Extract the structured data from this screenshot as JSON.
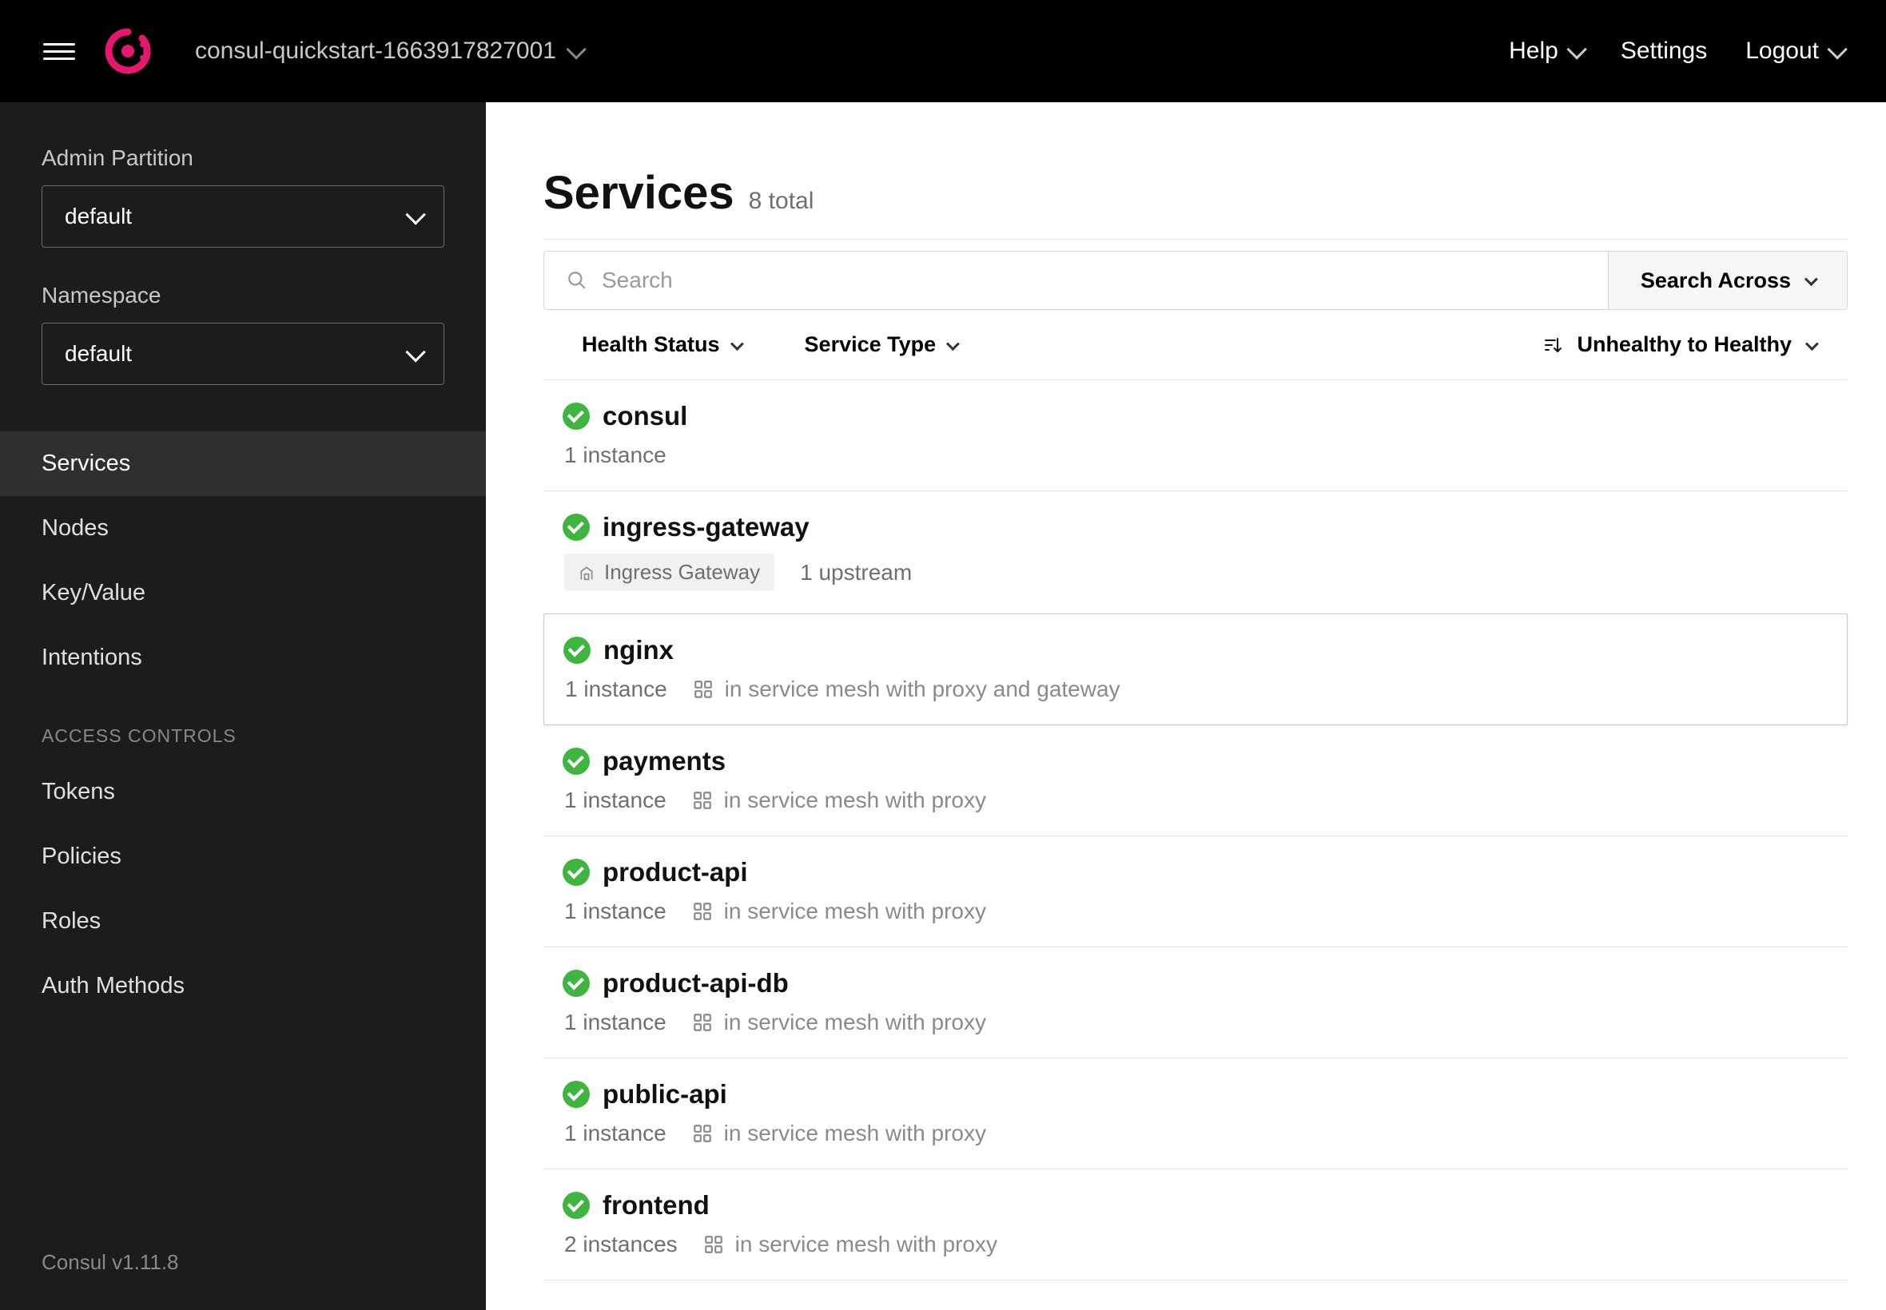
{
  "header": {
    "datacenter": "consul-quickstart-1663917827001",
    "help": "Help",
    "settings": "Settings",
    "logout": "Logout"
  },
  "sidebar": {
    "admin_partition_label": "Admin Partition",
    "admin_partition_value": "default",
    "namespace_label": "Namespace",
    "namespace_value": "default",
    "nav": {
      "services": "Services",
      "nodes": "Nodes",
      "keyvalue": "Key/Value",
      "intentions": "Intentions"
    },
    "access_controls_header": "ACCESS CONTROLS",
    "access": {
      "tokens": "Tokens",
      "policies": "Policies",
      "roles": "Roles",
      "auth_methods": "Auth Methods"
    },
    "version": "Consul v1.11.8"
  },
  "main": {
    "title": "Services",
    "subtitle": "8 total",
    "search_placeholder": "Search",
    "search_across": "Search Across",
    "filters": {
      "health_status": "Health Status",
      "service_type": "Service Type"
    },
    "sort_label": "Unhealthy to Healthy",
    "services": [
      {
        "name": "consul",
        "instances": "1 instance",
        "badge": null,
        "mesh": null,
        "extra": null
      },
      {
        "name": "ingress-gateway",
        "instances": null,
        "badge": "Ingress Gateway",
        "mesh": null,
        "extra": "1 upstream"
      },
      {
        "name": "nginx",
        "instances": "1 instance",
        "badge": null,
        "mesh": "in service mesh with proxy and gateway",
        "extra": null,
        "highlighted": true
      },
      {
        "name": "payments",
        "instances": "1 instance",
        "badge": null,
        "mesh": "in service mesh with proxy",
        "extra": null
      },
      {
        "name": "product-api",
        "instances": "1 instance",
        "badge": null,
        "mesh": "in service mesh with proxy",
        "extra": null
      },
      {
        "name": "product-api-db",
        "instances": "1 instance",
        "badge": null,
        "mesh": "in service mesh with proxy",
        "extra": null
      },
      {
        "name": "public-api",
        "instances": "1 instance",
        "badge": null,
        "mesh": "in service mesh with proxy",
        "extra": null
      },
      {
        "name": "frontend",
        "instances": "2 instances",
        "badge": null,
        "mesh": "in service mesh with proxy",
        "extra": null
      }
    ]
  }
}
